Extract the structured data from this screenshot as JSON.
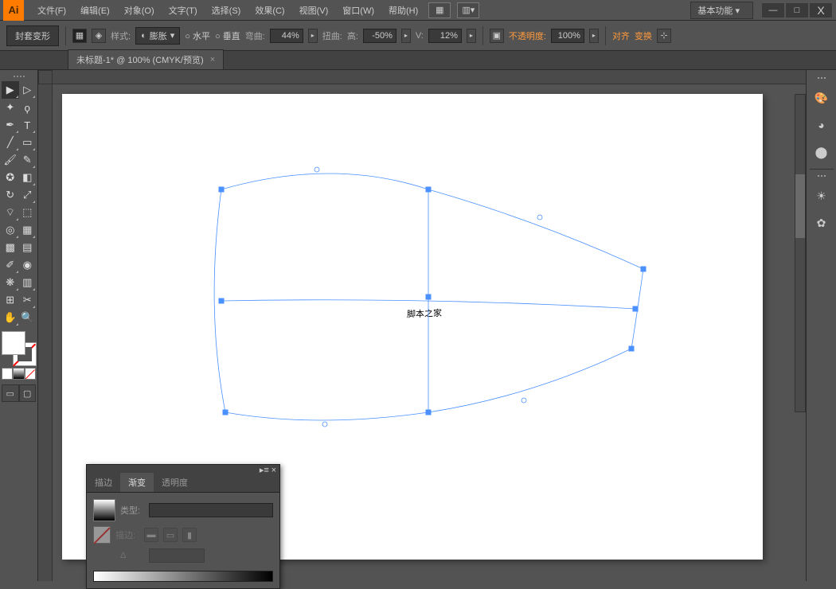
{
  "app": {
    "logo": "Ai"
  },
  "menu": {
    "items": [
      "文件(F)",
      "编辑(E)",
      "对象(O)",
      "文字(T)",
      "选择(S)",
      "效果(C)",
      "视图(V)",
      "窗口(W)",
      "帮助(H)"
    ],
    "workspace": "基本功能"
  },
  "options": {
    "tool_label": "封套变形",
    "style_label": "样式:",
    "style_value": "膨胀",
    "horizontal": "水平",
    "vertical": "垂直",
    "bend_label": "弯曲:",
    "bend_value": "44%",
    "distort_label": "扭曲:",
    "h_label": "高:",
    "h_value": "-50%",
    "v_label": "V:",
    "v_value": "12%",
    "opacity_label": "不透明度:",
    "opacity_value": "100%",
    "align": "对齐",
    "transform": "变换"
  },
  "doc": {
    "tab": "未标题-1* @ 100% (CMYK/预览)",
    "close": "×"
  },
  "canvas": {
    "text": "脚本之家"
  },
  "panel": {
    "tabs": [
      "描边",
      "渐变",
      "透明度"
    ],
    "type_label": "类型:",
    "stroke_label": "描边:",
    "angle": "Δ",
    "menu_glyph": "▸≡",
    "close": "×"
  },
  "win": {
    "min": "—",
    "max": "□",
    "close": "X"
  },
  "glyph": {
    "dd": "▾",
    "chev": "▸",
    "radio_on": "●",
    "radio_off": "○"
  }
}
